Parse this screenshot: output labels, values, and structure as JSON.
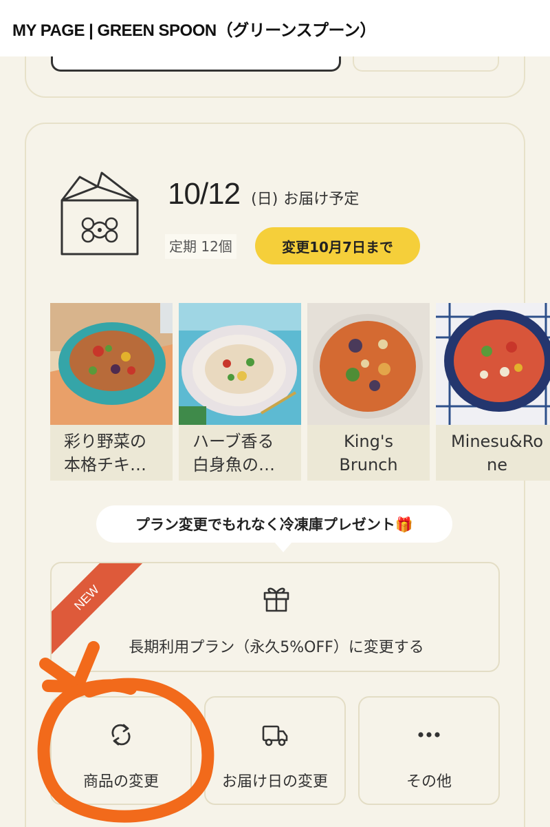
{
  "header": {
    "title": "MY PAGE | GREEN SPOON（グリーンスプーン）"
  },
  "delivery": {
    "date": "10/12",
    "day_of_week": "(日)",
    "label": "お届け予定",
    "plan": "定期 12個",
    "deadline": "変更10月7日まで"
  },
  "menu_items": [
    {
      "name": "彩り野菜の\n本格チキ…",
      "image": "turquoise-bowl-vegetable-keema"
    },
    {
      "name": "ハーブ香る\n白身魚の…",
      "image": "lace-plate-white-fish"
    },
    {
      "name": "King's\nBrunch",
      "image": "orange-curry-soup"
    },
    {
      "name": "Minesu&Ro\nne",
      "image": "blue-bowl-minestrone"
    }
  ],
  "promo_bubble": "プラン変更でもれなく冷凍庫プレゼント🎁",
  "plan_change": {
    "badge": "NEW",
    "icon": "gift-icon",
    "label": "長期利用プラン（永久5%OFF）に変更する"
  },
  "actions": [
    {
      "label": "商品の変更",
      "icon": "refresh-icon"
    },
    {
      "label": "お届け日の変更",
      "icon": "truck-icon"
    },
    {
      "label": "その他",
      "icon": "more-dots-icon"
    }
  ],
  "colors": {
    "background": "#f6f3e9",
    "accent_yellow": "#f5cf3a",
    "ribbon_red": "#de5a3a",
    "annotation_orange": "#f26a1b"
  }
}
